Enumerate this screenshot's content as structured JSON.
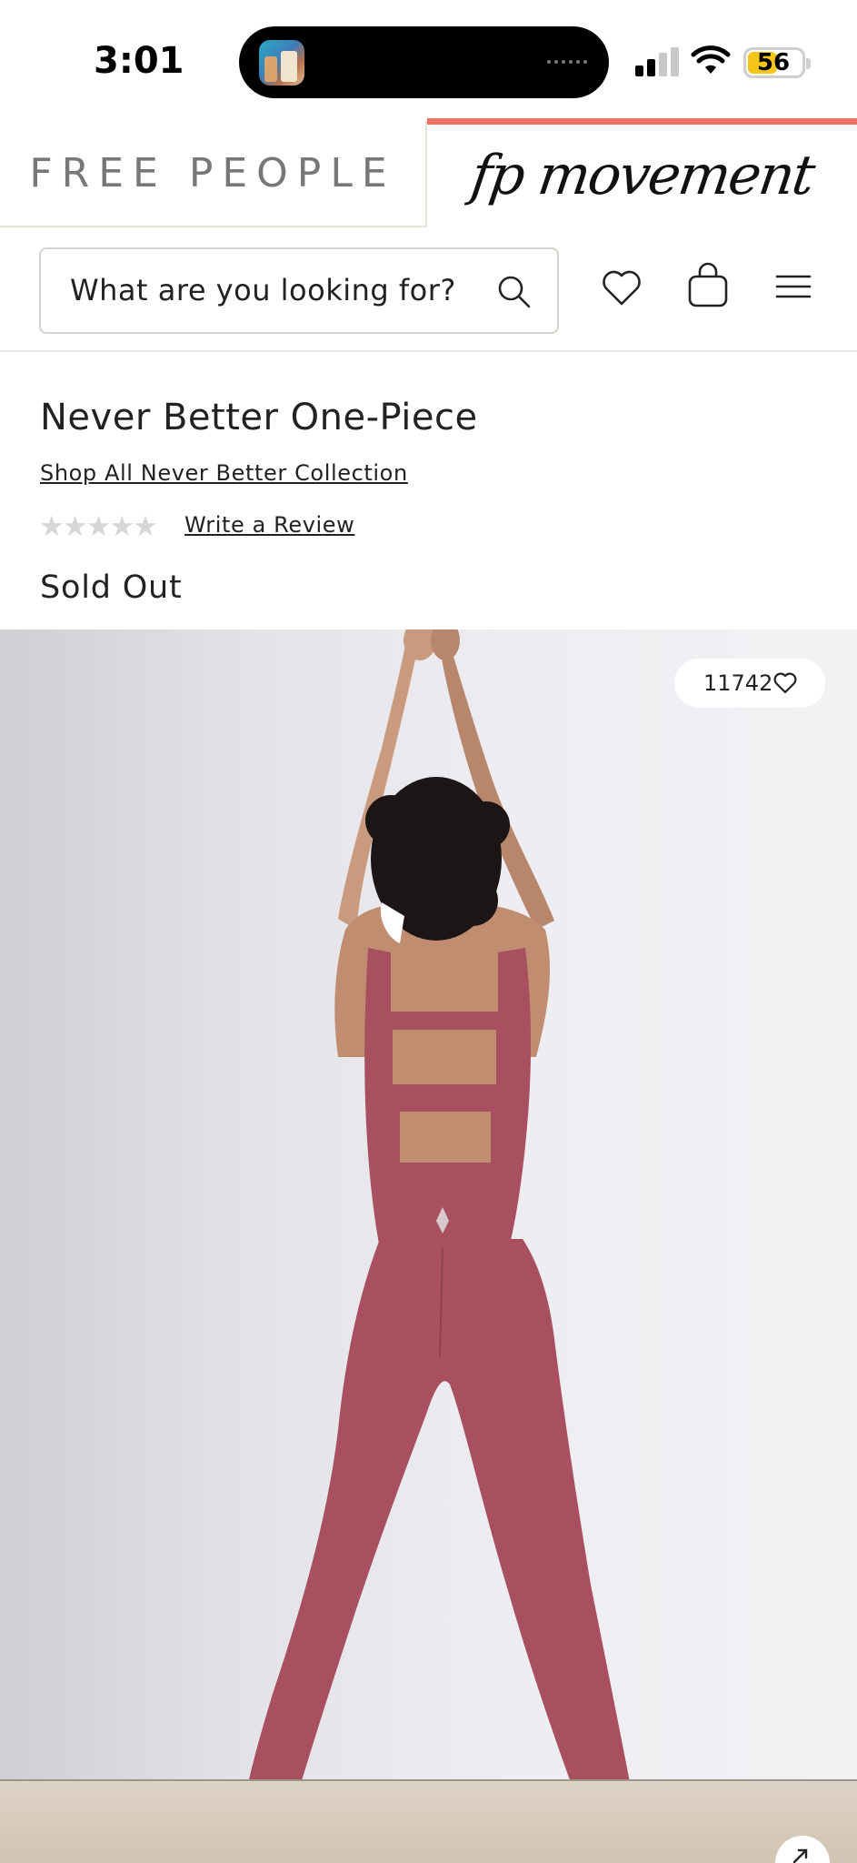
{
  "status_bar": {
    "time": "3:01",
    "battery_level": "56",
    "signal_bars": 2,
    "battery_color": "#f5c518"
  },
  "brand_tabs": {
    "free_people": "FREE PEOPLE",
    "fp_movement": "fp movement",
    "active_tab": "fp movement",
    "active_color": "#f07061"
  },
  "search": {
    "placeholder": "What are you looking for?"
  },
  "header_icons": [
    "search-icon",
    "heart-icon",
    "bag-icon",
    "menu-icon"
  ],
  "product": {
    "title": "Never Better One-Piece",
    "collection_link": "Shop All Never Better Collection",
    "stars": "★★★★★",
    "rating_filled": 0,
    "review_link": "Write a Review",
    "status": "Sold Out",
    "like_count": "11742",
    "garment_color": "#a8505f"
  }
}
